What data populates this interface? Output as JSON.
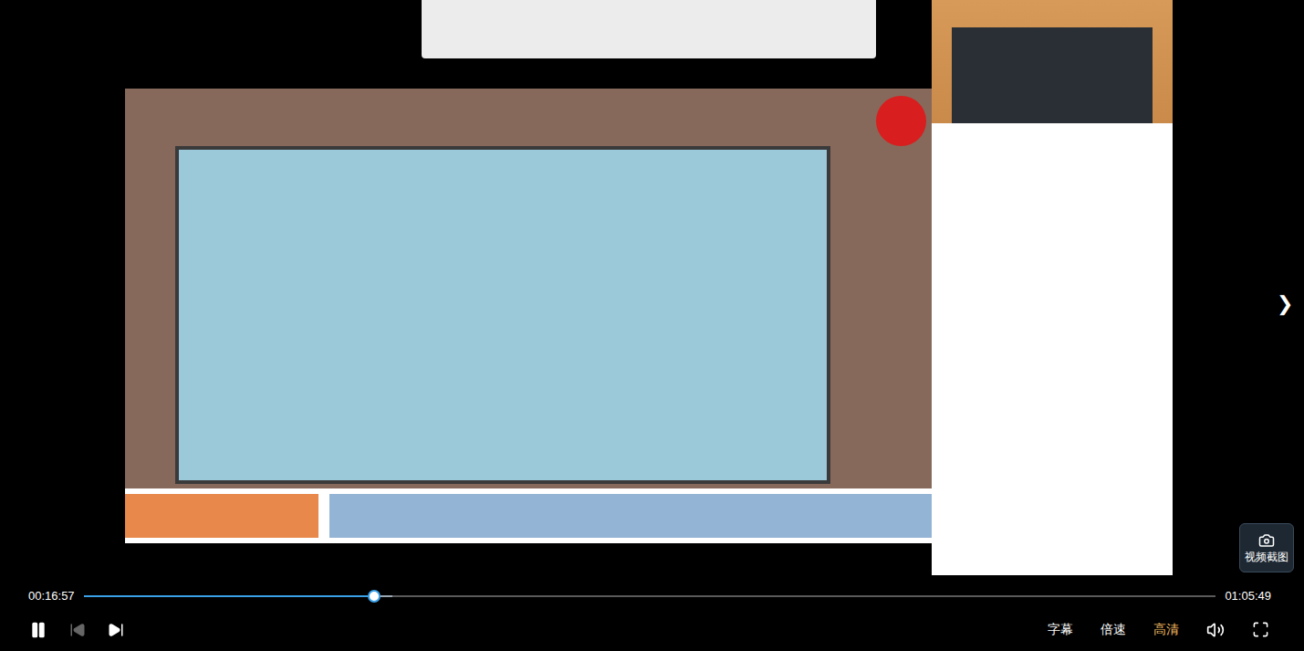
{
  "player": {
    "current_time": "00:16:57",
    "duration": "01:05:49",
    "progress": {
      "level": 0.257
    },
    "buffered": {
      "level": 0.273
    },
    "playing": true,
    "prev_disabled": true
  },
  "controls": [
    {
      "label": "字幕",
      "selected": false
    },
    {
      "label": "倍速",
      "selected": false
    },
    {
      "label": "高清",
      "selected": true
    }
  ],
  "screenshot_button": {
    "label": "视频截图"
  },
  "next_arrow": "❯"
}
